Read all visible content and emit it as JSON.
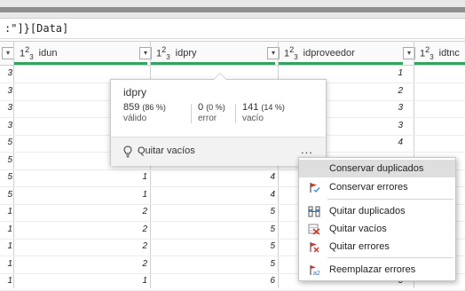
{
  "formula_text": ":\"]}[Data]",
  "columns": [
    {
      "type_base": "1",
      "type_sup": "2",
      "type_sub": "3",
      "name": "idun"
    },
    {
      "type_base": "1",
      "type_sup": "2",
      "type_sub": "3",
      "name": "idpry"
    },
    {
      "type_base": "1",
      "type_sup": "2",
      "type_sub": "3",
      "name": "idproveedor"
    },
    {
      "type_base": "1",
      "type_sup": "2",
      "type_sub": "3",
      "name": "idtnc"
    }
  ],
  "rows": [
    {
      "lead": "3",
      "idun": "",
      "idpry": "",
      "idproveedor": "1",
      "idtnc": ""
    },
    {
      "lead": "3",
      "idun": "",
      "idpry": "",
      "idproveedor": "2",
      "idtnc": ""
    },
    {
      "lead": "3",
      "idun": "",
      "idpry": "",
      "idproveedor": "3",
      "idtnc": ""
    },
    {
      "lead": "3",
      "idun": "",
      "idpry": "",
      "idproveedor": "3",
      "idtnc": ""
    },
    {
      "lead": "5",
      "idun": "",
      "idpry": "",
      "idproveedor": "4",
      "idtnc": ""
    },
    {
      "lead": "5",
      "idun": "",
      "idpry": "",
      "idproveedor": "",
      "idtnc": ""
    },
    {
      "lead": "5",
      "idun": "1",
      "idpry": "4",
      "idproveedor": "",
      "idtnc": ""
    },
    {
      "lead": "5",
      "idun": "1",
      "idpry": "4",
      "idproveedor": "",
      "idtnc": ""
    },
    {
      "lead": "1",
      "idun": "2",
      "idpry": "5",
      "idproveedor": "",
      "idtnc": ""
    },
    {
      "lead": "1",
      "idun": "2",
      "idpry": "5",
      "idproveedor": "",
      "idtnc": ""
    },
    {
      "lead": "1",
      "idun": "2",
      "idpry": "5",
      "idproveedor": "",
      "idtnc": ""
    },
    {
      "lead": "1",
      "idun": "2",
      "idpry": "5",
      "idproveedor": "",
      "idtnc": ""
    },
    {
      "lead": "1",
      "idun": "1",
      "idpry": "6",
      "idproveedor": "6",
      "idtnc": ""
    }
  ],
  "popup": {
    "column_name": "idpry",
    "valid_count": "859",
    "valid_pct": "(86 %)",
    "valid_label": "válido",
    "error_count": "0",
    "error_pct": "(0 %)",
    "error_label": "error",
    "empty_count": "141",
    "empty_pct": "(14 %)",
    "empty_label": "vacío",
    "action_label": "Quitar vacíos",
    "more_label": "..."
  },
  "menu": {
    "items": [
      {
        "label": "Conservar duplicados"
      },
      {
        "label": "Conservar errores"
      },
      {
        "label": "Quitar duplicados"
      },
      {
        "label": "Quitar vacíos"
      },
      {
        "label": "Quitar errores"
      },
      {
        "label": "Reemplazar errores"
      }
    ]
  },
  "icons": {
    "dropdown": "chevron-down-icon",
    "bulb": "lightbulb-icon",
    "menu_keep_errors": "keep-errors-icon",
    "menu_remove_dups": "remove-duplicates-icon",
    "menu_remove_empty": "remove-empty-icon",
    "menu_remove_errors": "remove-errors-icon",
    "menu_replace_errors": "replace-errors-icon"
  },
  "colors": {
    "quality_bar": "#2ea55f",
    "highlight": "#dedede"
  }
}
